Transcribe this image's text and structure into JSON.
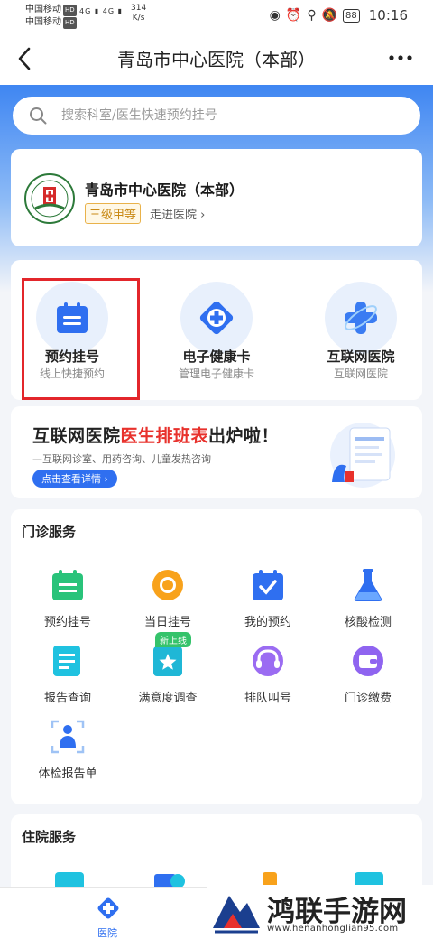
{
  "status_bar": {
    "carrier1": "中国移动",
    "carrier2": "中国移动",
    "hd": "HD",
    "net1": "4G",
    "net2": "4G",
    "speed_value": "314",
    "speed_unit": "K/s",
    "battery": "88",
    "time": "10:16"
  },
  "titlebar": {
    "title": "青岛市中心医院（本部）"
  },
  "search": {
    "placeholder": "搜索科室/医生快速预约挂号"
  },
  "hospital": {
    "name": "青岛市中心医院（本部）",
    "grade": "三级甲等",
    "enter_link": "走进医院 ›"
  },
  "quick_entries": [
    {
      "label": "预约挂号",
      "sub": "线上快捷预约",
      "icon": "calendar-icon"
    },
    {
      "label": "电子健康卡",
      "sub": "管理电子健康卡",
      "icon": "health-card-icon"
    },
    {
      "label": "互联网医院",
      "sub": "互联网医院",
      "icon": "internet-hospital-icon"
    }
  ],
  "banner": {
    "title_part1": "互联网医院",
    "title_red": "医生排班表",
    "title_part2": "出炉啦！",
    "subtitle": "—互联网诊室、用药咨询、儿童发热咨询",
    "button": "点击查看详情 ›"
  },
  "outpatient": {
    "title": "门诊服务",
    "new_tag": "新上线",
    "items": [
      {
        "label": "预约挂号",
        "icon": "calendar-icon"
      },
      {
        "label": "当日挂号",
        "icon": "sun-icon"
      },
      {
        "label": "我的预约",
        "icon": "check-calendar-icon"
      },
      {
        "label": "核酸检测",
        "icon": "flask-icon"
      },
      {
        "label": "报告查询",
        "icon": "report-icon"
      },
      {
        "label": "满意度调查",
        "icon": "star-note-icon"
      },
      {
        "label": "排队叫号",
        "icon": "headset-icon"
      },
      {
        "label": "门诊缴费",
        "icon": "wallet-icon"
      },
      {
        "label": "体检报告单",
        "icon": "body-scan-icon"
      }
    ]
  },
  "inpatient": {
    "title": "住院服务"
  },
  "tabbar": {
    "hospital_label": "医院"
  },
  "watermark": {
    "text": "鸿联手游网",
    "url": "www.henanhonglian95.com"
  },
  "colors": {
    "primary": "#2f6ff0",
    "highlight_border": "#e3262b",
    "banner_red": "#e8312c",
    "grade_gold": "#c98a16"
  }
}
